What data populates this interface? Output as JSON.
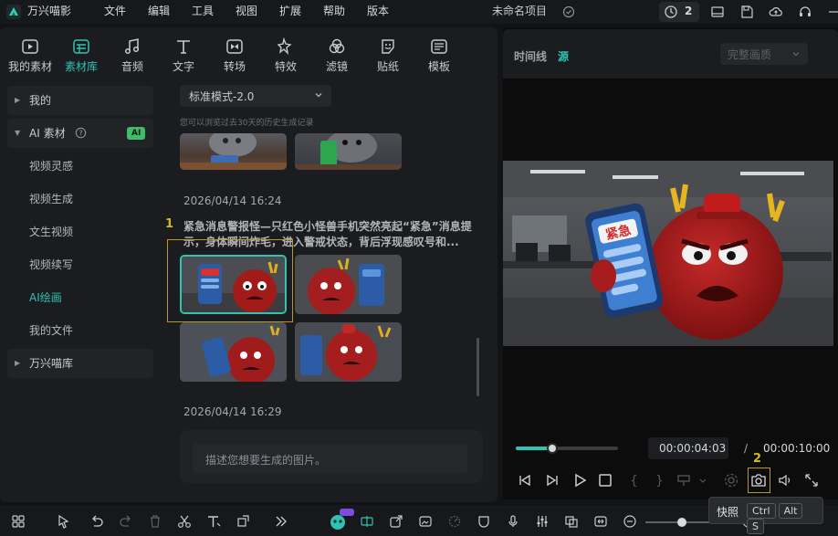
{
  "app": {
    "title": "万兴喵影",
    "project_name": "未命名项目",
    "notification_count": "2"
  },
  "menu": [
    "文件",
    "编辑",
    "工具",
    "视图",
    "扩展",
    "帮助",
    "版本"
  ],
  "tool_tabs": [
    {
      "label": "我的素材",
      "icon": "media-icon"
    },
    {
      "label": "素材库",
      "icon": "library-icon"
    },
    {
      "label": "音频",
      "icon": "music-icon"
    },
    {
      "label": "文字",
      "icon": "text-icon"
    },
    {
      "label": "转场",
      "icon": "transition-icon"
    },
    {
      "label": "特效",
      "icon": "effects-icon"
    },
    {
      "label": "滤镜",
      "icon": "filter-icon"
    },
    {
      "label": "贴纸",
      "icon": "sticker-icon"
    },
    {
      "label": "模板",
      "icon": "template-icon"
    }
  ],
  "sidebar": {
    "my": "我的",
    "ai_group": "AI 素材",
    "ai_badge": "AI",
    "ai_items": [
      "视频灵感",
      "视频生成",
      "文生视频",
      "视频续写",
      "AI绘画",
      "我的文件"
    ],
    "stock": "万兴喵库"
  },
  "content": {
    "mode_select": "标准模式-2.0",
    "history_hint": "您可以浏览过去30天的历史生成记录",
    "session1_time": "2026/04/14 16:24",
    "session1_marker": "1",
    "session1_prompt_line1": "紧急消息警报怪—只红色小怪兽手机突然亮起“紧急”消息提",
    "session1_prompt_line2": "示，身体瞬间炸毛，进入警戒状态，背后浮现感叹号和...",
    "session2_time": "2026/04/14 16:29",
    "prompt_placeholder": "描述您想要生成的图片。"
  },
  "preview": {
    "tab_timeline": "时间线",
    "tab_source": "源",
    "quality": "完整画质",
    "image_text": "紧急",
    "current_time": "00:00:04:03",
    "separator": "/",
    "total_time": "00:00:10:00",
    "progress": 0.36,
    "marker2": "2"
  },
  "tooltip": {
    "label": "快照",
    "keys": [
      "Ctrl",
      "Alt",
      "S"
    ]
  },
  "colors": {
    "accent": "#2fc3b0",
    "marker": "#d6b82a",
    "panel": "#1b1c1f"
  }
}
